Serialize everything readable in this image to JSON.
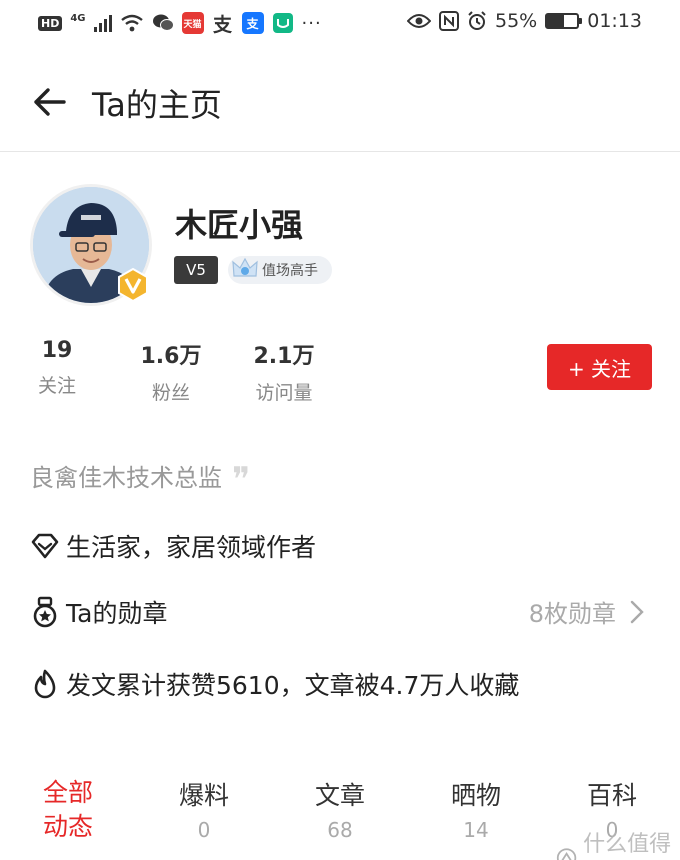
{
  "status_bar": {
    "hd": "HD",
    "network": "4G",
    "battery": "55%",
    "battery_level": 0.55,
    "time": "01:13",
    "app_tmall": "天猫",
    "app_alipay_a": "支",
    "app_alipay_b": "支",
    "more": "···"
  },
  "header": {
    "title": "Ta的主页"
  },
  "profile": {
    "name": "木匠小强",
    "level": "V5",
    "expert_label": "值场高手"
  },
  "stats": [
    {
      "value": "19",
      "label": "关注"
    },
    {
      "value": "1.6万",
      "label": "粉丝"
    },
    {
      "value": "2.1万",
      "label": "访问量"
    }
  ],
  "follow_button": "+ 关注",
  "bio": "良禽佳木技术总监",
  "identity": "生活家，家居领域作者",
  "medals": {
    "label": "Ta的勋章",
    "count": "8枚勋章"
  },
  "likes_summary": "发文累计获赞5610，文章被4.7万人收藏",
  "tabs": [
    {
      "label_line1": "全部",
      "label_line2": "动态"
    },
    {
      "label": "爆料",
      "count": "0"
    },
    {
      "label": "文章",
      "count": "68"
    },
    {
      "label": "晒物",
      "count": "14"
    },
    {
      "label": "百科",
      "count": "0"
    }
  ],
  "watermark": "什么值得买",
  "colors": {
    "accent": "#e62828",
    "text": "#222222",
    "muted": "#999999"
  }
}
